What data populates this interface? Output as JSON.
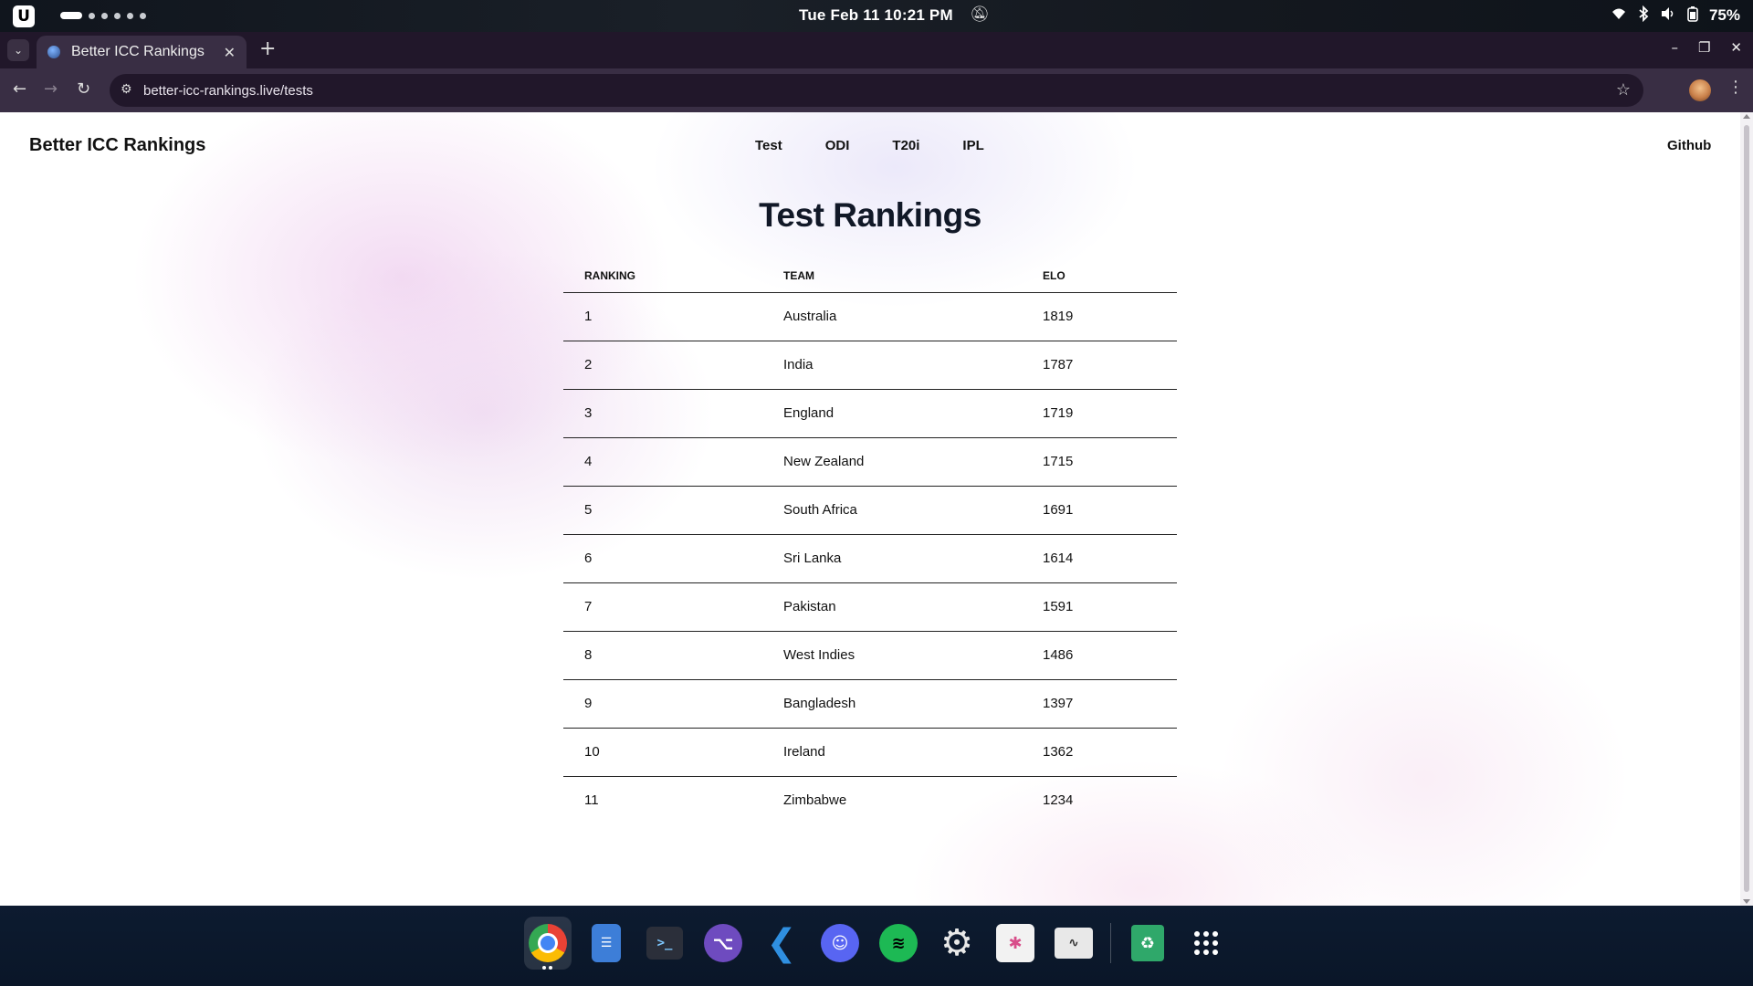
{
  "system": {
    "clock": "Tue Feb 11  10:21 PM",
    "battery": "75%",
    "os_logo_icon": "ubuntu-style-logo",
    "workspace_count": 6
  },
  "browser": {
    "tab_title": "Better ICC Rankings",
    "url": "better-icc-rankings.live/tests"
  },
  "site": {
    "title": "Better ICC Rankings",
    "nav": [
      "Test",
      "ODI",
      "T20i",
      "IPL"
    ],
    "github": "Github",
    "heading": "Test Rankings",
    "table": {
      "headers": [
        "RANKING",
        "TEAM",
        "ELO"
      ],
      "rows": [
        [
          "1",
          "Australia",
          "1819"
        ],
        [
          "2",
          "India",
          "1787"
        ],
        [
          "3",
          "England",
          "1719"
        ],
        [
          "4",
          "New Zealand",
          "1715"
        ],
        [
          "5",
          "South Africa",
          "1691"
        ],
        [
          "6",
          "Sri Lanka",
          "1614"
        ],
        [
          "7",
          "Pakistan",
          "1591"
        ],
        [
          "8",
          "West Indies",
          "1486"
        ],
        [
          "9",
          "Bangladesh",
          "1397"
        ],
        [
          "10",
          "Ireland",
          "1362"
        ],
        [
          "11",
          "Zimbabwe",
          "1234"
        ]
      ]
    }
  },
  "dock": {
    "apps": [
      "chrome",
      "files",
      "terminal",
      "github-desktop",
      "vscode",
      "discord",
      "spotify",
      "settings",
      "app-store",
      "system-monitor",
      "trash",
      "app-grid"
    ]
  },
  "colors": {
    "tab_strip": "#21172a",
    "toolbar": "#392e44",
    "dock": "#0b1a2e"
  }
}
